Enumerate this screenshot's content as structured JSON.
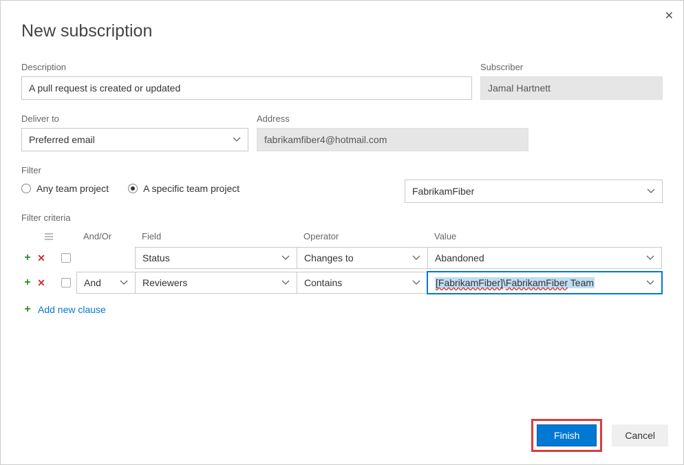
{
  "dialog": {
    "title": "New subscription",
    "close": "✕"
  },
  "fields": {
    "description_label": "Description",
    "description_value": "A pull request is created or updated",
    "subscriber_label": "Subscriber",
    "subscriber_value": "Jamal Hartnett",
    "deliver_label": "Deliver to",
    "deliver_value": "Preferred email",
    "address_label": "Address",
    "address_value": "fabrikamfiber4@hotmail.com",
    "filter_label": "Filter",
    "project_select": "FabrikamFiber"
  },
  "radios": {
    "any": "Any team project",
    "specific": "A specific team project"
  },
  "criteria": {
    "label": "Filter criteria",
    "headers": {
      "andor": "And/Or",
      "field": "Field",
      "operator": "Operator",
      "value": "Value"
    },
    "rows": [
      {
        "andor": "",
        "field": "Status",
        "operator": "Changes to",
        "value": "Abandoned"
      },
      {
        "andor": "And",
        "field": "Reviewers",
        "operator": "Contains",
        "value_bracket": "[FabrikamFiber]",
        "value_slash": "\\",
        "value_name": "FabrikamFiber",
        "value_tail": " Team"
      }
    ],
    "add_new": "Add new clause"
  },
  "buttons": {
    "finish": "Finish",
    "cancel": "Cancel"
  },
  "icons": {
    "chevron_down": "chev"
  }
}
